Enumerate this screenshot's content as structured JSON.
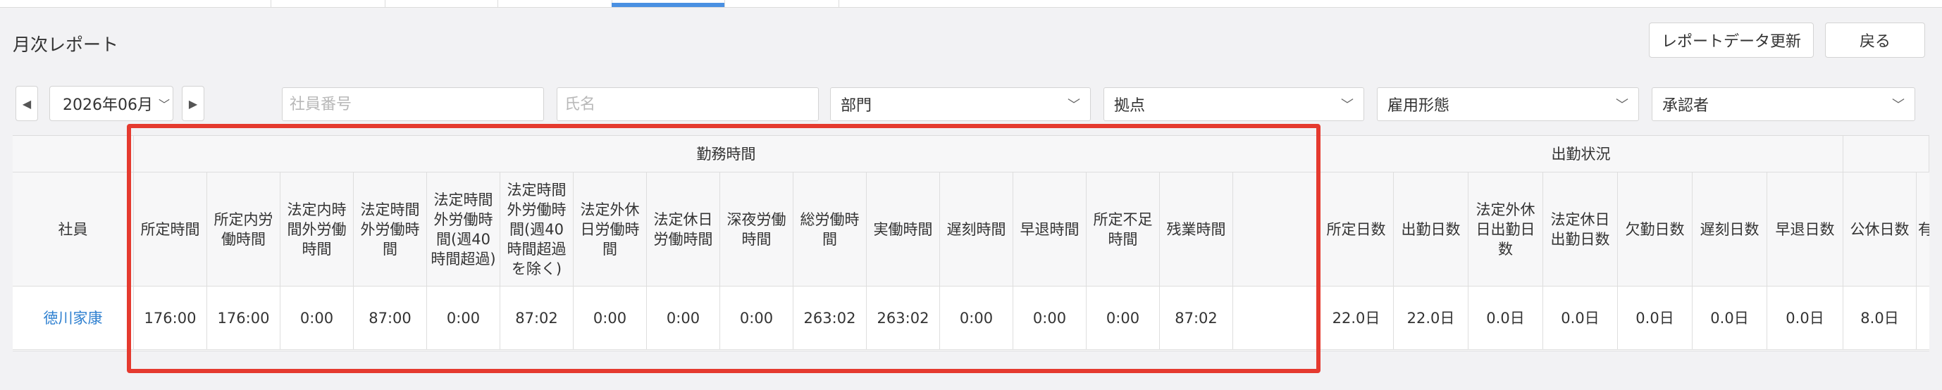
{
  "page": {
    "title": "月次レポート"
  },
  "buttons": {
    "refresh": "レポートデータ更新",
    "back": "戻る"
  },
  "filters": {
    "prev_icon": "caret-left-icon",
    "next_icon": "caret-right-icon",
    "month": "2026年06月",
    "employee_number_placeholder": "社員番号",
    "name_placeholder": "氏名",
    "department": "部門",
    "location": "拠点",
    "employment_type": "雇用形態",
    "approver": "承認者"
  },
  "table": {
    "groups": {
      "work_hours": "勤務時間",
      "attendance": "出勤状況"
    },
    "employee_header": "社員",
    "work_hour_columns": [
      "所定時間",
      "所定内労働時間",
      "法定内時間外労働時間",
      "法定時間外労働時間",
      "法定時間外労働時間(週40時間超過)",
      "法定時間外労働時間(週40時間超過を除く)",
      "法定外休日労働時間",
      "法定休日労働時間",
      "深夜労働時間",
      "総労働時間",
      "実働時間",
      "遅刻時間",
      "早退時間",
      "所定不足時間",
      "残業時間",
      ""
    ],
    "attendance_columns": [
      "所定日数",
      "出勤日数",
      "法定外休日出勤日数",
      "法定休日出勤日数",
      "欠勤日数",
      "遅刻日数",
      "早退日数"
    ],
    "extra_columns": [
      "公休日数",
      "有"
    ],
    "rows": [
      {
        "employee": "徳川家康",
        "work_hours": [
          "176:00",
          "176:00",
          "0:00",
          "87:00",
          "0:00",
          "87:02",
          "0:00",
          "0:00",
          "0:00",
          "263:02",
          "263:02",
          "0:00",
          "0:00",
          "0:00",
          "87:02",
          ""
        ],
        "attendance": [
          "22.0日",
          "22.0日",
          "0.0日",
          "0.0日",
          "0.0日",
          "0.0日",
          "0.0日"
        ],
        "extra": [
          "8.0日",
          ""
        ]
      }
    ]
  },
  "colors": {
    "highlight": "#e53a2f",
    "link": "#2f80d0",
    "tab_active": "#4a90e2"
  }
}
